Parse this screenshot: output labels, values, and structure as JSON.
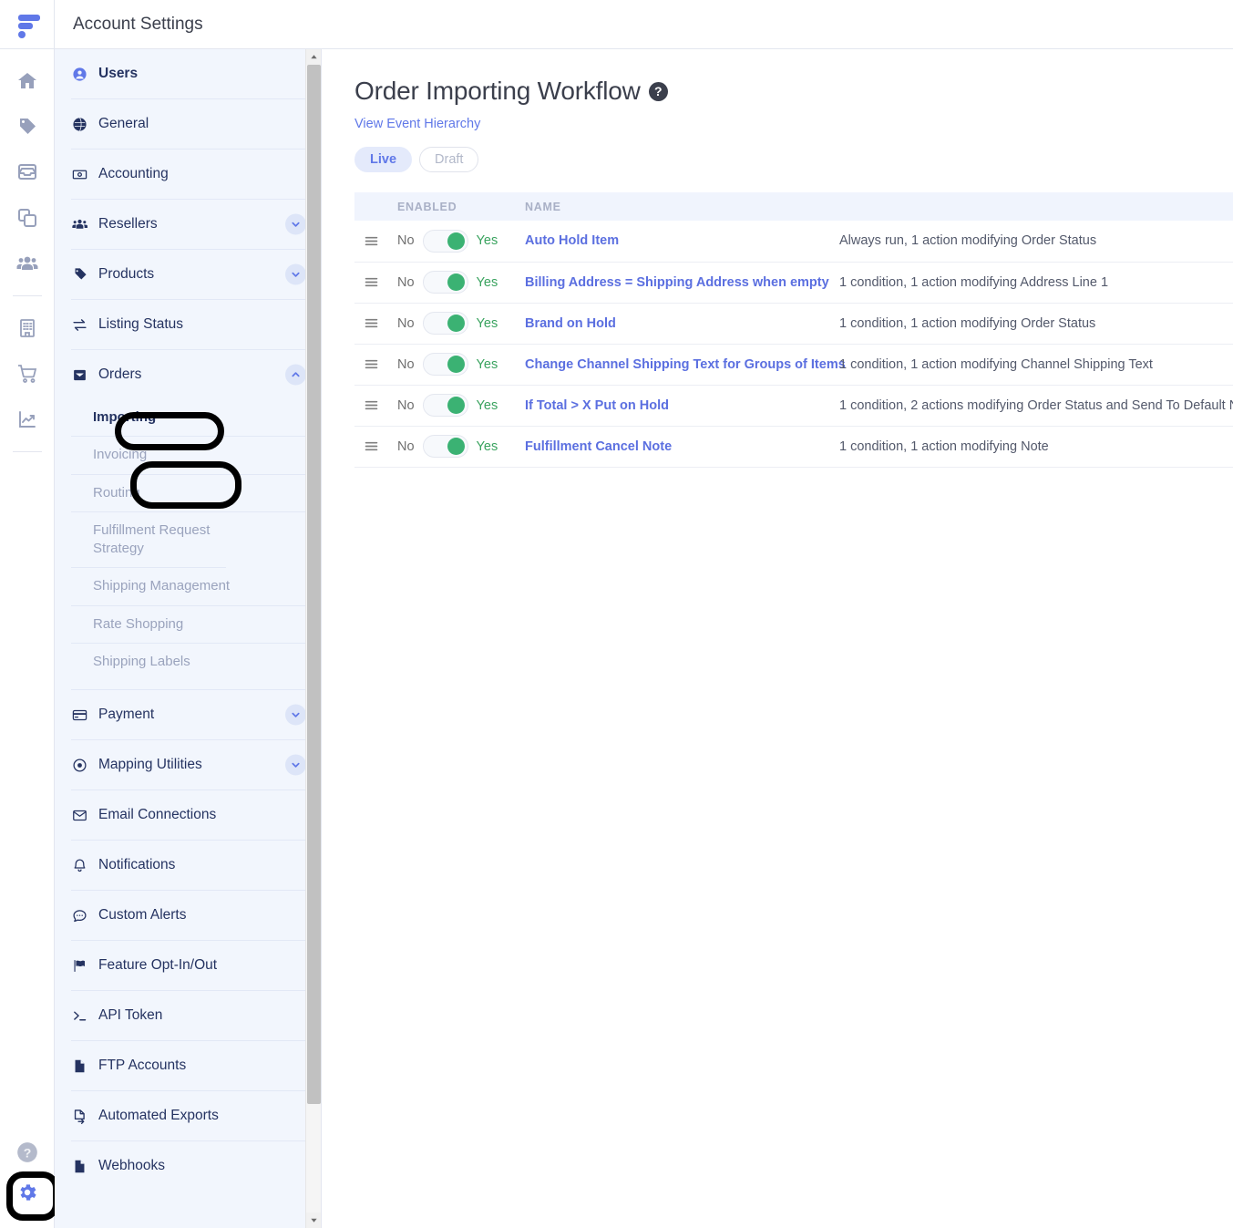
{
  "brand": {
    "logo": "flxpoint-logo",
    "accent": "#6078e8"
  },
  "topbar": {
    "title": "Account Settings"
  },
  "rail": {
    "icons": [
      {
        "name": "home-icon"
      },
      {
        "name": "tag-icon"
      },
      {
        "name": "inbox-icon"
      },
      {
        "name": "copy-documents-icon"
      },
      {
        "name": "users-group-icon"
      },
      {
        "name": "building-icon"
      },
      {
        "name": "shopping-cart-icon"
      },
      {
        "name": "analytics-chart-icon"
      }
    ],
    "help": "help-circle-icon",
    "settings": "gear-icon"
  },
  "sidebar": {
    "items": [
      {
        "label": "Users",
        "icon": "user-circle-icon",
        "active": true,
        "expandable": false
      },
      {
        "label": "General",
        "icon": "globe-icon",
        "active": false,
        "expandable": false
      },
      {
        "label": "Accounting",
        "icon": "banknote-icon",
        "active": false,
        "expandable": false
      },
      {
        "label": "Resellers",
        "icon": "people-icon",
        "active": false,
        "expandable": true,
        "expanded": false
      },
      {
        "label": "Products",
        "icon": "tag-icon",
        "active": false,
        "expandable": true,
        "expanded": false
      },
      {
        "label": "Listing Status",
        "icon": "exchange-arrows-icon",
        "active": false,
        "expandable": false
      },
      {
        "label": "Orders",
        "icon": "inbox-icon",
        "active": false,
        "expandable": true,
        "expanded": true,
        "highlighted": true
      },
      {
        "label": "Payment",
        "icon": "credit-card-icon",
        "active": false,
        "expandable": true,
        "expanded": false
      },
      {
        "label": "Mapping Utilities",
        "icon": "target-icon",
        "active": false,
        "expandable": true,
        "expanded": false
      },
      {
        "label": "Email Connections",
        "icon": "envelope-icon",
        "active": false,
        "expandable": false
      },
      {
        "label": "Notifications",
        "icon": "bell-icon",
        "active": false,
        "expandable": false
      },
      {
        "label": "Custom Alerts",
        "icon": "chat-bubble-icon",
        "active": false,
        "expandable": false
      },
      {
        "label": "Feature Opt-In/Out",
        "icon": "flag-icon",
        "active": false,
        "expandable": false
      },
      {
        "label": "API Token",
        "icon": "terminal-icon",
        "active": false,
        "expandable": false
      },
      {
        "label": "FTP Accounts",
        "icon": "file-icon",
        "active": false,
        "expandable": false
      },
      {
        "label": "Automated Exports",
        "icon": "file-export-icon",
        "active": false,
        "expandable": false
      },
      {
        "label": "Webhooks",
        "icon": "file-icon",
        "active": false,
        "expandable": false
      }
    ],
    "orders_sub": [
      {
        "label": "Importing",
        "current": true,
        "highlighted": true
      },
      {
        "label": "Invoicing",
        "current": false
      },
      {
        "label": "Routing",
        "current": false
      },
      {
        "label": "Fulfillment Request Strategy",
        "current": false
      },
      {
        "label": "Shipping Management",
        "current": false
      },
      {
        "label": "Rate Shopping",
        "current": false
      },
      {
        "label": "Shipping Labels",
        "current": false
      }
    ]
  },
  "main": {
    "title": "Order Importing Workflow",
    "help_icon": "question-mark-icon",
    "hierarchy_link": "View Event Hierarchy",
    "segments": [
      {
        "label": "Live",
        "active": true
      },
      {
        "label": "Draft",
        "active": false
      }
    ],
    "table": {
      "headers": {
        "handle": "",
        "enabled": "ENABLED",
        "name": "NAME",
        "description": ""
      },
      "toggle_labels": {
        "off": "No",
        "on": "Yes"
      },
      "rows": [
        {
          "enabled": true,
          "name": "Auto Hold Item",
          "description": "Always run, 1 action modifying Order Status"
        },
        {
          "enabled": true,
          "name": "Billing Address = Shipping Address when empty",
          "description": "1 condition, 1 action modifying Address Line 1"
        },
        {
          "enabled": true,
          "name": "Brand on Hold",
          "description": "1 condition, 1 action modifying Order Status"
        },
        {
          "enabled": true,
          "name": "Change Channel Shipping Text for Groups of Items",
          "description": "1 condition, 1 action modifying Channel Shipping Text"
        },
        {
          "enabled": true,
          "name": "If Total > X Put on Hold",
          "description": "1 condition, 2 actions modifying Order Status and Send To Default N"
        },
        {
          "enabled": true,
          "name": "Fulfillment Cancel Note",
          "description": "1 condition, 1 action modifying Note"
        }
      ]
    }
  }
}
